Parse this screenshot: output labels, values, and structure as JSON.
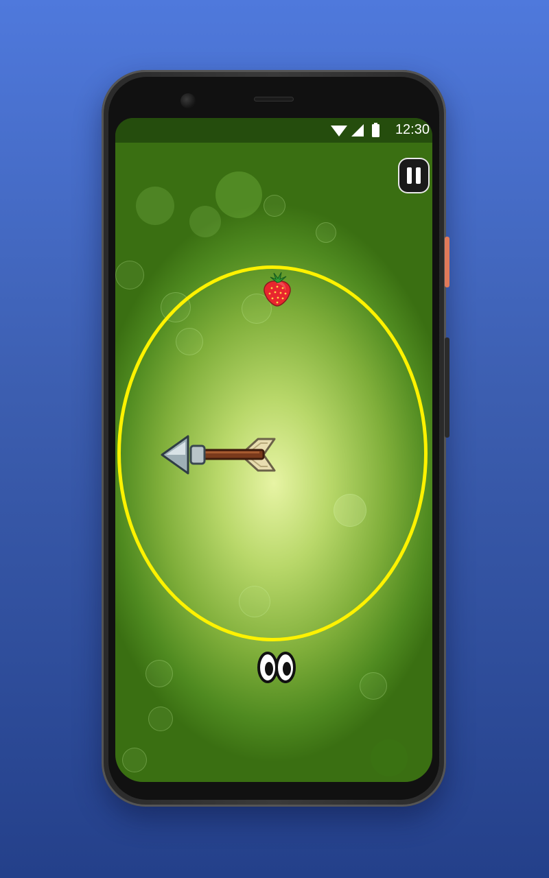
{
  "status_bar": {
    "time": "12:30",
    "icons": [
      "wifi-icon",
      "cell-signal-icon",
      "battery-icon"
    ]
  },
  "game": {
    "controls": {
      "pause_icon": "pause-icon"
    },
    "sprites": [
      "track-ring",
      "strawberry",
      "arrow",
      "eyes"
    ]
  },
  "colors": {
    "background_top": "#4f79dc",
    "background_bottom": "#24408a",
    "ring": "#fff200",
    "accent_button": "#e07a5a"
  }
}
